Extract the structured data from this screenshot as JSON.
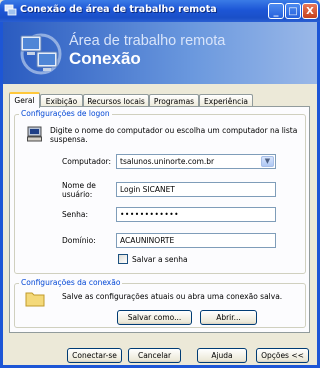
{
  "window": {
    "title": "Conexão de área de trabalho remota",
    "minimize_glyph": "_",
    "maximize_glyph": "□",
    "close_glyph": "X"
  },
  "banner": {
    "line1": "Área de trabalho remota",
    "line2": "Conexão",
    "icon": "remote-desktop-computers-icon"
  },
  "tabs": [
    "Geral",
    "Exibição",
    "Recursos locais",
    "Programas",
    "Experiência"
  ],
  "logon": {
    "group_label": "Configurações de logon",
    "instruction": "Digite o nome do computador ou escolha um computador na lista suspensa.",
    "computer_label": "Computador:",
    "computer_value": "tsalunos.uninorte.com.br",
    "username_label": "Nome de usuário:",
    "username_value": "Login SICANET",
    "password_label": "Senha:",
    "password_value": "••••••••••••",
    "domain_label": "Domínio:",
    "domain_value": "ACAUNINORTE",
    "save_password_label": "Salvar a senha",
    "save_password_checked": false
  },
  "connection": {
    "group_label": "Configurações da conexão",
    "description": "Salve as configurações atuais ou abra uma conexão salva.",
    "save_as_label": "Salvar como...",
    "open_label": "Abrir..."
  },
  "footer": {
    "connect_label": "Conectar-se",
    "cancel_label": "Cancelar",
    "help_label": "Ajuda",
    "options_label": "Opções <<"
  },
  "colors": {
    "title_blue": "#1d56d6",
    "group_label_blue": "#0046d5",
    "window_bg": "#ece9d8"
  }
}
